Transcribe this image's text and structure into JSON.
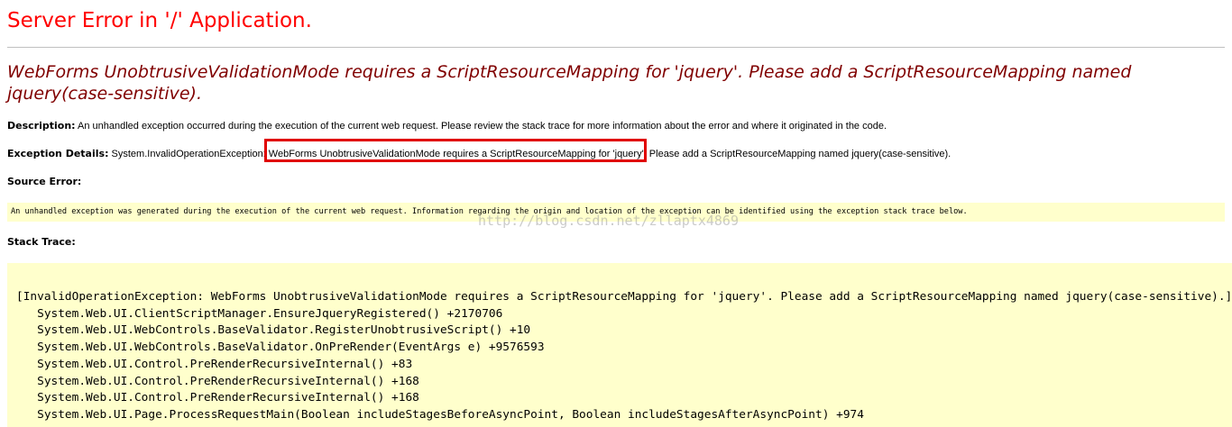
{
  "page": {
    "title": "Server Error in '/' Application.",
    "subtitle": "WebForms UnobtrusiveValidationMode requires a ScriptResourceMapping for 'jquery'. Please add a ScriptResourceMapping named jquery(case-sensitive)."
  },
  "description": {
    "label": "Description:",
    "text": " An unhandled exception occurred during the execution of the current web request. Please review the stack trace for more information about the error and where it originated in the code."
  },
  "exception": {
    "label": "Exception Details:",
    "type": " System.InvalidOperationException:",
    "message": " WebForms UnobtrusiveValidationMode requires a ScriptResourceMapping for 'jquery'. Please add a ScriptResourceMapping named jquery(case-sensitive)."
  },
  "source_error": {
    "label": "Source Error:",
    "text": "An unhandled exception was generated during the execution of the current web request. Information regarding the origin and location of the exception can be identified using the exception stack trace below."
  },
  "watermark": "http://blog.csdn.net/zllaptx4869",
  "stack": {
    "label": "Stack Trace:",
    "lines": [
      "[InvalidOperationException: WebForms UnobtrusiveValidationMode requires a ScriptResourceMapping for 'jquery'. Please add a ScriptResourceMapping named jquery(case-sensitive).]",
      "   System.Web.UI.ClientScriptManager.EnsureJqueryRegistered() +2170706",
      "   System.Web.UI.WebControls.BaseValidator.RegisterUnobtrusiveScript() +10",
      "   System.Web.UI.WebControls.BaseValidator.OnPreRender(EventArgs e) +9576593",
      "   System.Web.UI.Control.PreRenderRecursiveInternal() +83",
      "   System.Web.UI.Control.PreRenderRecursiveInternal() +168",
      "   System.Web.UI.Control.PreRenderRecursiveInternal() +168",
      "   System.Web.UI.Page.ProcessRequestMain(Boolean includeStagesBeforeAsyncPoint, Boolean includeStagesAfterAsyncPoint) +974"
    ]
  },
  "colors": {
    "title": "#ff0000",
    "subtitle": "#800000",
    "code_background": "#ffffcc",
    "highlight_border": "#e00000"
  }
}
